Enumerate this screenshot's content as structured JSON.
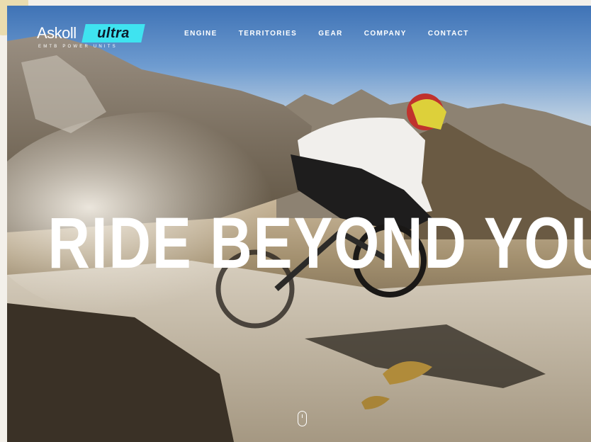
{
  "brand": {
    "name": "Askoll",
    "badge": "ultra",
    "tagline": "EMTB POWER UNITS",
    "accent_color": "#3fe3f0"
  },
  "nav": {
    "items": [
      {
        "label": "ENGINE"
      },
      {
        "label": "TERRITORIES"
      },
      {
        "label": "GEAR"
      },
      {
        "label": "COMPANY"
      },
      {
        "label": "CONTACT"
      }
    ]
  },
  "hero": {
    "headline": "RIDE BEYOND YOUR",
    "scroll_icon": "mouse-scroll-icon"
  }
}
